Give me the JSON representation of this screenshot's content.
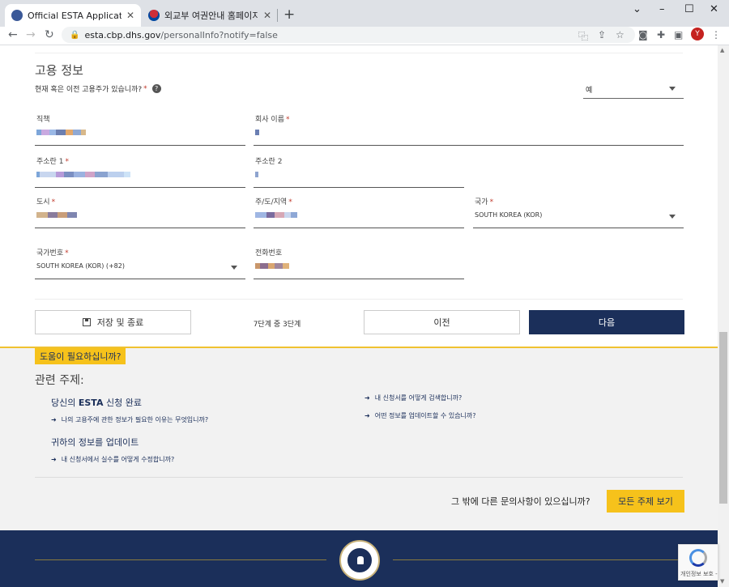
{
  "browser": {
    "tabs": [
      {
        "title": "Official ESTA Application Websi",
        "favicon_color": "#3b5998"
      },
      {
        "title": "외교부 여권안내 홈페이지",
        "favicon_color": "#cd2e3a"
      }
    ],
    "url_host": "esta.cbp.dhs.gov",
    "url_path": "/personalInfo?notify=false",
    "avatar_letter": "Y"
  },
  "employment": {
    "section_title": "고용 정보",
    "question": "현재 혹은 이전 고용주가 있습니까?",
    "answer": "예",
    "fields": {
      "job_title": {
        "label": "직책"
      },
      "company": {
        "label": "회사 이름"
      },
      "address1": {
        "label": "주소란 1"
      },
      "address2": {
        "label": "주소란 2"
      },
      "city": {
        "label": "도시"
      },
      "state": {
        "label": "주/도/지역"
      },
      "country": {
        "label": "국가",
        "value": "SOUTH KOREA (KOR)"
      },
      "country_code": {
        "label": "국가번호",
        "value": "SOUTH KOREA (KOR) (+82)"
      },
      "phone": {
        "label": "전화번호"
      }
    }
  },
  "actions": {
    "save_exit": "저장 및 종료",
    "step": "7단계 중 3단계",
    "previous": "이전",
    "next": "다음"
  },
  "help": {
    "tag": "도움이 필요하십니까?",
    "related_title": "관련 주제:",
    "group1_prefix": "당신의 ",
    "group1_bold": "ESTA",
    "group1_suffix": " 신청 완료",
    "link1": "나의 고용주에 관한 정보가 필요한 이유는 무엇입니까?",
    "group2": "귀하의 정보를 업데이트",
    "link2": "내 신청서에서 실수를 어떻게 수정합니까?",
    "link3": "내 신청서를 어떻게 검색합니까?",
    "link4": "어떤 정보를 업데이트할 수 있습니까?",
    "other_question": "그 밖에 다른 문의사항이 있으십니까?",
    "view_all": "모든 주제 보기"
  },
  "recaptcha_text": "개인정보 보호 -",
  "colors": {
    "navy": "#1b2f5a",
    "gold": "#f6c21b",
    "required": "#c0392b"
  }
}
